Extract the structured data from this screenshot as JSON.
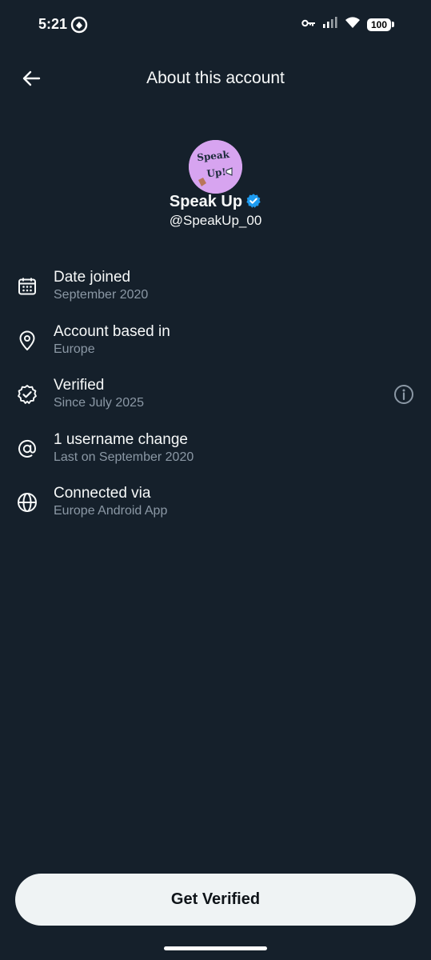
{
  "status_bar": {
    "time": "5:21",
    "battery": "100",
    "icons": [
      "app-notification-icon",
      "key-icon",
      "signal-icon",
      "wifi-icon",
      "battery-icon"
    ]
  },
  "header": {
    "title": "About this account",
    "back_icon": "arrow-left-icon"
  },
  "profile": {
    "name": "Speak Up",
    "handle": "@SpeakUp_00",
    "verified": true,
    "avatar_text": [
      "Speak",
      "Up!"
    ],
    "badge_color": "#1d9bf0",
    "avatar_color": "#d7a4f0"
  },
  "info": [
    {
      "icon": "calendar-icon",
      "primary": "Date joined",
      "secondary": "September 2020"
    },
    {
      "icon": "location-pin-icon",
      "primary": "Account based in",
      "secondary": "Europe"
    },
    {
      "icon": "verified-check-icon",
      "primary": "Verified",
      "secondary": "Since July 2025",
      "action_icon": "info-icon"
    },
    {
      "icon": "at-sign-icon",
      "primary": "1 username change",
      "secondary": "Last on September 2020"
    },
    {
      "icon": "globe-icon",
      "primary": "Connected via",
      "secondary": "Europe Android App"
    }
  ],
  "cta": {
    "label": "Get Verified"
  },
  "colors": {
    "background": "#15202b",
    "primary_text": "#f7f9f9",
    "secondary_text": "#8b98a5",
    "button_bg": "#eff3f4"
  }
}
